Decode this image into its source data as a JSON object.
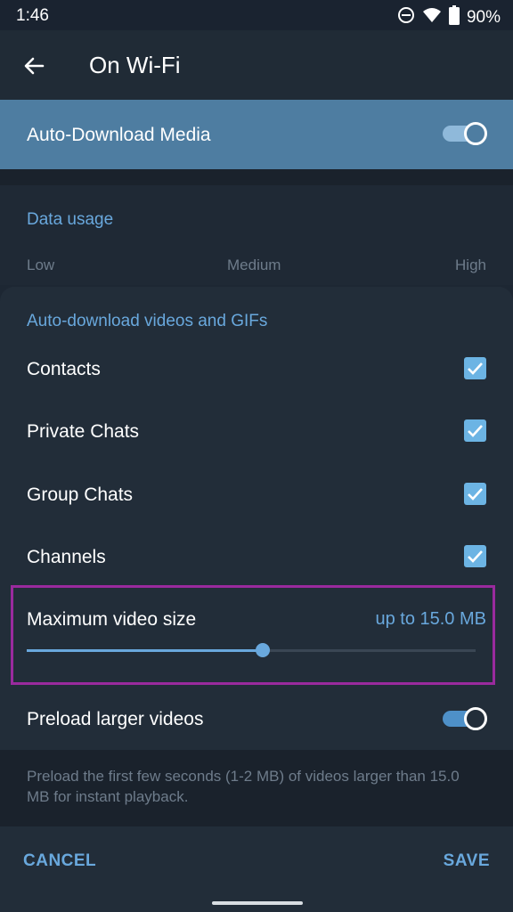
{
  "status_bar": {
    "time": "1:46",
    "battery_percent": "90%",
    "icons": [
      "dnd-icon",
      "wifi-icon",
      "battery-icon"
    ]
  },
  "app_bar": {
    "title": "On Wi-Fi",
    "back_icon": "arrow-left-icon"
  },
  "master_toggle": {
    "label": "Auto-Download Media",
    "enabled": true
  },
  "data_usage": {
    "title": "Data usage",
    "scale": [
      "Low",
      "Medium",
      "High"
    ]
  },
  "videos_section": {
    "title": "Auto-download videos and GIFs",
    "items": [
      {
        "label": "Contacts",
        "checked": true
      },
      {
        "label": "Private Chats",
        "checked": true
      },
      {
        "label": "Group Chats",
        "checked": true
      },
      {
        "label": "Channels",
        "checked": true
      }
    ],
    "max_size": {
      "label": "Maximum video size",
      "value": "up to 15.0 MB",
      "slider_fraction": 0.525
    },
    "preload": {
      "label": "Preload larger videos",
      "enabled": true
    }
  },
  "footer_note": "Preload the first few seconds (1-2 MB) of videos larger than 15.0 MB for instant playback.",
  "actions": {
    "cancel": "CANCEL",
    "save": "SAVE"
  },
  "colors": {
    "accent": "#69a8dd",
    "header_highlight": "#4e7da1",
    "annotation_border": "#9a2a9e",
    "background": "#1d2733"
  }
}
